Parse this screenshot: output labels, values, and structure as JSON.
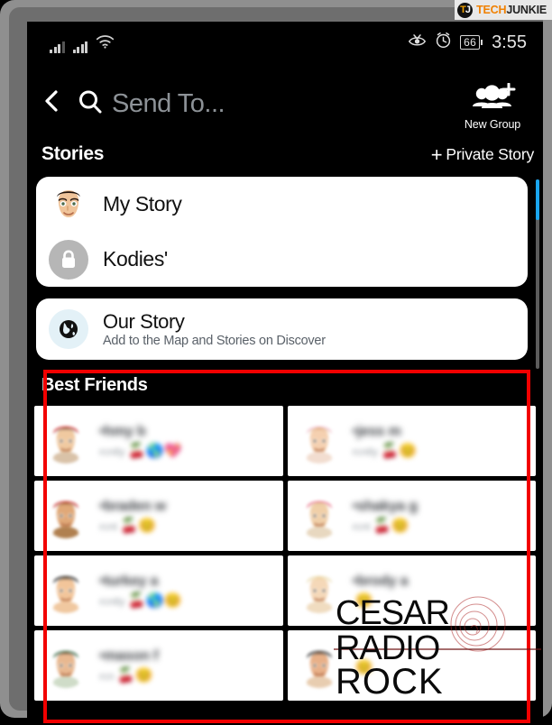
{
  "watermark_brand": {
    "line1": "CESAR",
    "line2": "RADIO",
    "line3": "ROCK"
  },
  "site_badge": {
    "mark_primary": "T",
    "mark_secondary": "J",
    "name_primary": "TECH",
    "name_secondary": "JUNKIE"
  },
  "status_bar": {
    "signal_icon_1": "signal-bars-icon",
    "signal_icon_2": "signal-bars-icon",
    "wifi_icon": "wifi-icon",
    "eye_icon": "eye-slash-icon",
    "alarm_icon": "alarm-clock-icon",
    "battery_level": "66",
    "time": "3:55"
  },
  "header": {
    "back_icon": "back-chevron-icon",
    "search_icon": "search-icon",
    "search_value": "",
    "search_placeholder": "Send To...",
    "new_group_icon": "add-group-icon",
    "new_group_label": "New Group"
  },
  "stories": {
    "section_title": "Stories",
    "private_story_plus": "+",
    "private_story_label": "Private Story",
    "items": [
      {
        "label": "My Story",
        "icon": "bitmoji-avatar"
      },
      {
        "label": "Kodies'",
        "icon": "lock-icon"
      }
    ],
    "our_story": {
      "title": "Our Story",
      "subtitle": "Add to the Map and Stories on Discover",
      "icon": "globe-icon"
    }
  },
  "best_friends": {
    "section_title": "Best Friends",
    "friends": [
      {
        "name": "•hmy b",
        "sub": "rcntly",
        "emojis": "🍒🌎💖",
        "avatar_bg": "#d9c2a8",
        "hat": "#d02020",
        "hair": "#3a2418",
        "skin": "#f0c9a0"
      },
      {
        "name": "•jess m",
        "sub": "rcntly",
        "emojis": "🍒😊",
        "avatar_bg": "#f2ddd0",
        "hat": "#f0b8c8",
        "hair": "#c98f56",
        "skin": "#f5d0b0"
      },
      {
        "name": "•braden w",
        "sub": "rcnt",
        "emojis": "🍒😊",
        "avatar_bg": "#b08050",
        "hat": "#c81818",
        "hair": "#6b3a16",
        "skin": "#e0a878"
      },
      {
        "name": "•shakya g",
        "sub": "rcnt",
        "emojis": "🍒😊",
        "avatar_bg": "#e8d8c0",
        "hat": "#e85878",
        "hair": "#d8c08a",
        "skin": "#f0cfa8"
      },
      {
        "name": "•turkey a",
        "sub": "rcntly",
        "emojis": "🍒🌎😊",
        "avatar_bg": "#f0c8a0",
        "hat": "#111111",
        "hair": "#111111",
        "skin": "#f2c59a"
      },
      {
        "name": "•brody a",
        "sub": "",
        "emojis": "😊",
        "avatar_bg": "#f0dcc0",
        "hat": "#e8d8a8",
        "hair": "#e8cf92",
        "skin": "#f5d8b8"
      },
      {
        "name": "•mason f",
        "sub": "rcn",
        "emojis": "🍒😊",
        "avatar_bg": "#cfdcc8",
        "hat": "#1f5c30",
        "hair": "#2a1a10",
        "skin": "#e8b890"
      },
      {
        "name": "",
        "sub": "",
        "emojis": "😊",
        "avatar_bg": "#e8cdb0",
        "hat": "#1a1a1a",
        "hair": "#1a1a1a",
        "skin": "#e8b088"
      }
    ]
  },
  "colors": {
    "accent_blue": "#1aa6f0",
    "annotation_red": "#f20000",
    "brand_orange": "#f08000",
    "card_white": "#ffffff",
    "screen_black": "#000000"
  }
}
